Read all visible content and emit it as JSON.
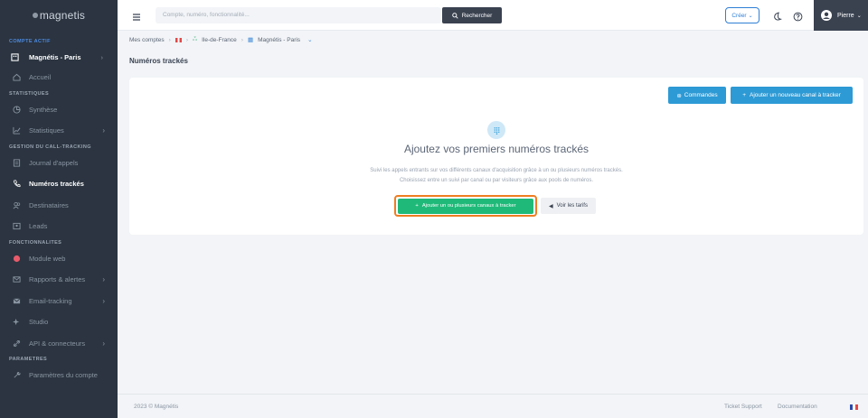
{
  "sidebar": {
    "logo": "magnetis",
    "active_account_label": "COMPTE ACTIF",
    "account_name": "Magnétis - Paris",
    "accueil": "Accueil",
    "sections": [
      {
        "title": "STATISTIQUES",
        "items": [
          "Synthèse",
          "Statistiques"
        ]
      },
      {
        "title": "GESTION DU CALL-TRACKING",
        "items": [
          "Journal d'appels",
          "Numéros trackés",
          "Destinataires",
          "Leads"
        ]
      },
      {
        "title": "FONCTIONNALITES",
        "items": [
          "Module web",
          "Rapports & alertes",
          "Email-tracking",
          "Studio",
          "API & connecteurs"
        ]
      },
      {
        "title": "PARAMETRES",
        "items": [
          "Paramètres du compte"
        ]
      }
    ]
  },
  "topbar": {
    "search_placeholder": "Compte, numéro, fonctionnalité...",
    "search_button": "Rechercher",
    "create_button": "Créer",
    "user_name": "Pierre"
  },
  "breadcrumb": {
    "root": "Mes comptes",
    "region": "Ile-de-France",
    "account": "Magnétis - Paris"
  },
  "page": {
    "title": "Numéros trackés",
    "commandes_button": "Commandes",
    "add_channel_button": "Ajouter un nouveau canal à tracker",
    "empty_title": "Ajoutez vos premiers numéros trackés",
    "empty_desc_line1": "Suivi les appels entrants sur vos différents canaux d'acquisition grâce à un ou plusieurs numéros trackés.",
    "empty_desc_line2": "Choisissez entre un suivi par canal ou par visiteurs grâce aux pools de numéros.",
    "primary_button": "Ajouter un ou plusieurs canaux à tracker",
    "tarifs_button": "Voir les tarifs"
  },
  "footer": {
    "copyright": "2023 © Magnétis",
    "support": "Ticket Support",
    "documentation": "Documentation"
  },
  "colors": {
    "sidebar_bg": "#2b3440",
    "accent_blue": "#2d9ad5",
    "primary_green": "#1fba79",
    "highlight_orange": "#ef7d22"
  }
}
